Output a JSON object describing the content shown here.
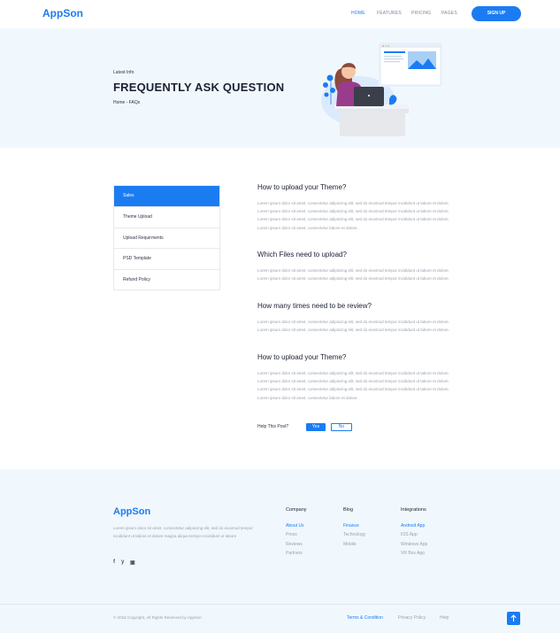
{
  "brand": {
    "name": "AppSon",
    "accent": "#1b7cf2"
  },
  "nav": {
    "items": [
      "HOME",
      "FEATURES",
      "PRICING",
      "PAGES"
    ],
    "active": "HOME",
    "signup_label": "SIGN UP"
  },
  "hero": {
    "kicker": "Latest Info",
    "title": "FREQUENTLY ASK QUESTION",
    "breadcrumb": "Home - FAQs",
    "illustration": "person-at-laptop-illustration"
  },
  "sidebar": {
    "items": [
      {
        "label": "Sales",
        "active": true
      },
      {
        "label": "Theme Upload",
        "active": false
      },
      {
        "label": "Upload Requirments",
        "active": false
      },
      {
        "label": "PSD Template",
        "active": false
      },
      {
        "label": "Refund Policy",
        "active": false
      }
    ]
  },
  "faqs": [
    {
      "question": "How to upload your Theme?",
      "answer": "Lorem ipsum dolor sit amet, consectetur adipiscing elit, sed do eiusmod tempor incididunt ut labore et dolore. Lorem ipsum dolor sit amet, consectetur adipiscing elit, sed do eiusmod tempor incididunt ut labore et dolore. Lorem ipsum dolor sit amet, consectetur adipiscing elit, sed do eiusmod tempor incididunt ut labore et dolore. Lorem ipsum dolor sit amet, consectetur labore et dolore."
    },
    {
      "question": "Which Files need to upload?",
      "answer": "Lorem ipsum dolor sit amet, consectetur adipiscing elit, sed do eiusmod tempor incididunt ut labore et dolore. Lorem ipsum dolor sit amet, consectetur adipiscing elit, sed do eiusmod tempor incididunt ut labore et dolore."
    },
    {
      "question": "How many times need to be review?",
      "answer": "Lorem ipsum dolor sit amet, consectetur adipiscing elit, sed do eiusmod tempor incididunt ut labore et dolore. Lorem ipsum dolor sit amet, consectetur adipiscing elit, sed do eiusmod tempor incididunt ut labore et dolore."
    },
    {
      "question": "How to upload your Theme?",
      "answer": "Lorem ipsum dolor sit amet, consectetur adipiscing elit, sed do eiusmod tempor incididunt ut labore et dolore. Lorem ipsum dolor sit amet, consectetur adipiscing elit, sed do eiusmod tempor incididunt ut labore et dolore. Lorem ipsum dolor sit amet, consectetur adipiscing elit, sed do eiusmod tempor incididunt ut labore et dolore. Lorem ipsum dolor sit amet, consectetur labore et dolore."
    }
  ],
  "feedback": {
    "prompt": "Help This Post?",
    "yes": "Yes",
    "no": "No"
  },
  "footer": {
    "logo": "AppSon",
    "description": "Lorem ipsum dolor sit amet, consectetur adipiscing elit, sed do eiusmod tempor incididunt ut labore et dolore magna aliqua tempor incididunt ut labore",
    "social": [
      "f",
      "y",
      "▣"
    ],
    "columns": [
      {
        "title": "Company",
        "links": [
          "About Us",
          "Press",
          "Reviews",
          "Partners"
        ]
      },
      {
        "title": "Blog",
        "links": [
          "Finance",
          "Technology",
          "Mobile"
        ]
      },
      {
        "title": "Integrations",
        "links": [
          "Android App",
          "IOS App",
          "Windows App",
          "VR Box App"
        ]
      }
    ],
    "copyright": "© 2018 Copyright, All Rights Reserved by AppSon",
    "bottom_links": [
      "Terms & Condition",
      "Privacy Policy",
      "Help"
    ]
  }
}
